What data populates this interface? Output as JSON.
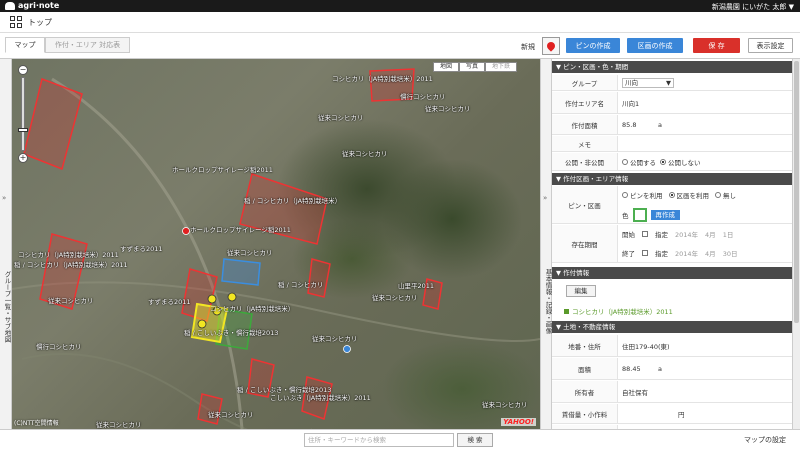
{
  "app": {
    "name": "agri·note",
    "user": "新潟農園 にいがた 太郎",
    "dropdown_arrow": "▼"
  },
  "breadcrumb": {
    "title": "トップ"
  },
  "tabs": [
    {
      "label": "マップ"
    },
    {
      "label": "作付・エリア 対応表"
    }
  ],
  "toolbar": {
    "new_label": "新規",
    "pin_create": "ピンの作成",
    "area_create": "区画の作成",
    "save": "保 存",
    "display_settings": "表示設定"
  },
  "left_tab": {
    "arrows": "»",
    "label": "グループ一覧・サブ地図"
  },
  "mid_tab": {
    "arrows": "»",
    "label": "基本情報・記録・画像"
  },
  "map": {
    "types": [
      "地図",
      "写真",
      "地下鉄"
    ],
    "zoom_in": "+",
    "zoom_out": "−",
    "copyright": "(C)NTT空間情報",
    "provider": "YAHOO!",
    "labels": [
      "コシヒカリ（JA特別栽培米）2011",
      "慣行コシヒカリ",
      "従来コシヒカリ",
      "従来コシヒカリ",
      "従来コシヒカリ",
      "ホールクロップサイレージ稲2011",
      "稲 / コシヒカリ（JA特別栽培米）",
      "ホールクロップサイレージ稲2011",
      "すずまる2011",
      "コシヒカリ（JA特別栽培米）2011",
      "稲 / コシヒカリ（JA特別栽培米）2011",
      "従来コシヒカリ",
      "従来コシヒカリ",
      "稲 / コシヒカリ",
      "すずまる2011",
      "コシヒカリ（JA特別栽培米）",
      "稲 / こしいぶき・慣行栽培2013",
      "慣行コシヒカリ",
      "従来コシヒカリ",
      "山里平2011",
      "従来コシヒカリ",
      "稲 / こしいぶき・慣行栽培2013",
      "こしいぶき（JA特別栽培米）2011",
      "従来コシヒカリ",
      "従来コシヒカリ",
      "従来コシヒカリ"
    ]
  },
  "panel": {
    "section1": "▼ ピン・区画・色・期間",
    "group_label": "グループ",
    "group_value": "川向",
    "area_name_label": "作付エリア名",
    "area_name_value": "川向1",
    "area_size_label": "作付面積",
    "area_size_value": "85.8",
    "area_unit": "a",
    "memo_label": "メモ",
    "public_label": "公開・非公開",
    "public_on": "公開する",
    "public_off": "公開しない",
    "section2": "▼ 作付区画・エリア情報",
    "pin_area_label": "ピン・区画",
    "opt_pin": "ピンを利用",
    "opt_area": "区画を利用",
    "opt_none": "無し",
    "color_label": "色",
    "reselect": "再作成",
    "period_label": "存在期間",
    "start_label": "開始",
    "end_label": "終了",
    "specify": "指定",
    "year": "2014年",
    "start_month": "4月",
    "start_day": "1日",
    "end_month": "4月",
    "end_day": "30日",
    "section3": "▼ 作付情報",
    "edit": "編集",
    "crop_item": "コシヒカリ（JA特別栽培米）2011",
    "section4": "▼ 土地・不動産情報",
    "lot_label": "地番・住所",
    "lot_value": "住田179-40(東)",
    "land_size_label": "面積",
    "land_size_value": "88.45",
    "land_unit": "a",
    "owner_label": "所有者",
    "owner_value": "自社保有",
    "rent_label": "賃借量・小作料",
    "rent_unit": "円",
    "memo2_label": "メモ"
  },
  "bottom": {
    "search_placeholder": "住所・キーワードから検索",
    "search_button": "検 索",
    "map_settings": "マップの設定"
  }
}
